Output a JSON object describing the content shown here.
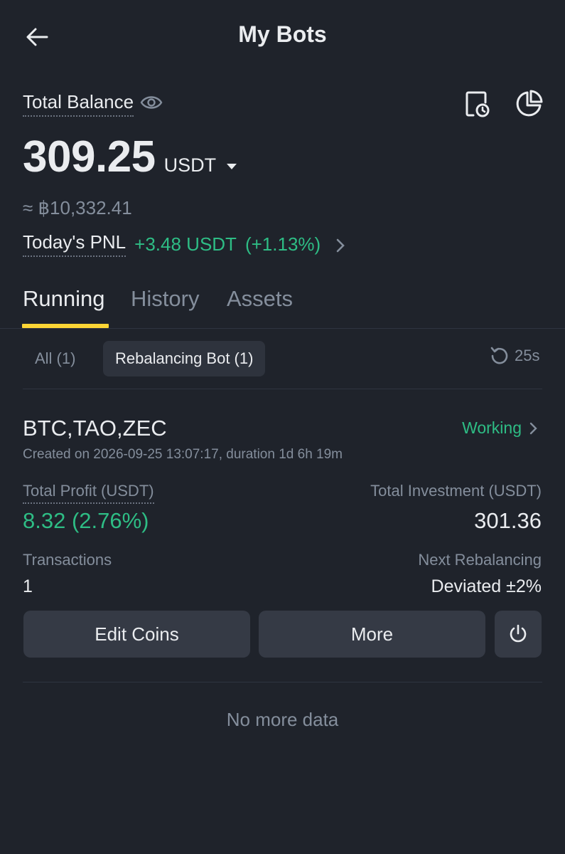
{
  "header": {
    "title": "My Bots"
  },
  "balance": {
    "label": "Total Balance",
    "amount": "309.25",
    "currency": "USDT",
    "approx": "≈ ฿10,332.41",
    "pnl_label": "Today's PNL",
    "pnl_value": "+3.48 USDT",
    "pnl_percent": "(+1.13%)"
  },
  "tabs": [
    {
      "label": "Running",
      "active": true
    },
    {
      "label": "History",
      "active": false
    },
    {
      "label": "Assets",
      "active": false
    }
  ],
  "filters": {
    "all": "All (1)",
    "rebalancing": "Rebalancing Bot (1)",
    "refresh": "25s"
  },
  "bot": {
    "name": "BTC,TAO,ZEC",
    "status": "Working",
    "created": "Created on 2026-09-25 13:07:17, duration 1d 6h 19m",
    "profit_label": "Total Profit (USDT)",
    "profit_value": "8.32 (2.76%)",
    "investment_label": "Total Investment (USDT)",
    "investment_value": "301.36",
    "transactions_label": "Transactions",
    "transactions_value": "1",
    "next_label": "Next Rebalancing",
    "next_value": "Deviated ±2%",
    "edit_button": "Edit Coins",
    "more_button": "More"
  },
  "footer": {
    "no_more": "No more data"
  },
  "colors": {
    "background": "#1f232b",
    "accent_yellow": "#fcd535",
    "positive_green": "#2ebd85",
    "button_bg": "#353a45"
  }
}
